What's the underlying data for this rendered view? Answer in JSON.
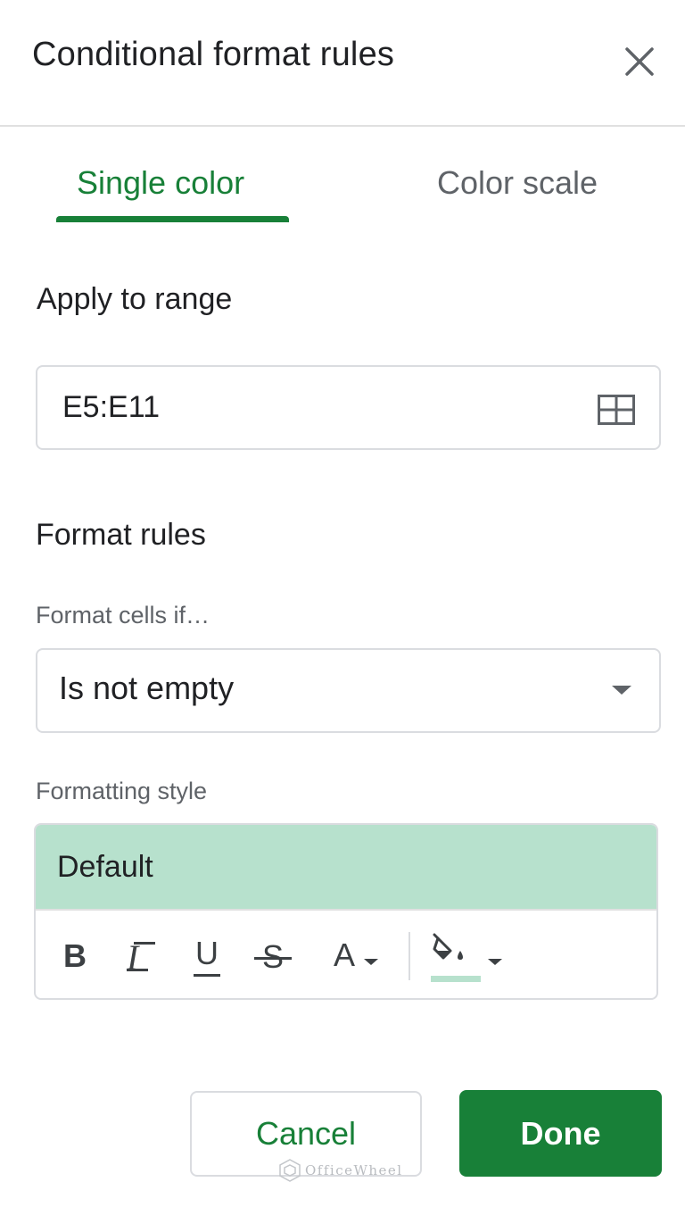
{
  "header": {
    "title": "Conditional format rules",
    "close_icon": "close-icon"
  },
  "tabs": [
    {
      "label": "Single color",
      "active": true
    },
    {
      "label": "Color scale",
      "active": false
    }
  ],
  "apply_range": {
    "title": "Apply to range",
    "value": "E5:E11",
    "select_range_icon": "grid-icon"
  },
  "format_rules": {
    "title": "Format rules",
    "condition_label": "Format cells if…",
    "condition_value": "Is not empty",
    "style_label": "Formatting style",
    "style_preview_text": "Default",
    "style_preview_color": "#b7e1cd"
  },
  "toolbar": {
    "bold": "B",
    "italic": "I",
    "underline": "U",
    "strikethrough": "S",
    "text_color": "A",
    "fill_color_icon": "paint-bucket-icon",
    "fill_color": "#b7e1cd"
  },
  "actions": {
    "cancel": "Cancel",
    "done": "Done"
  },
  "watermark": {
    "text": "OfficeWheel"
  },
  "colors": {
    "accent": "#188038",
    "muted": "#5f6368",
    "border": "#dadce0"
  }
}
